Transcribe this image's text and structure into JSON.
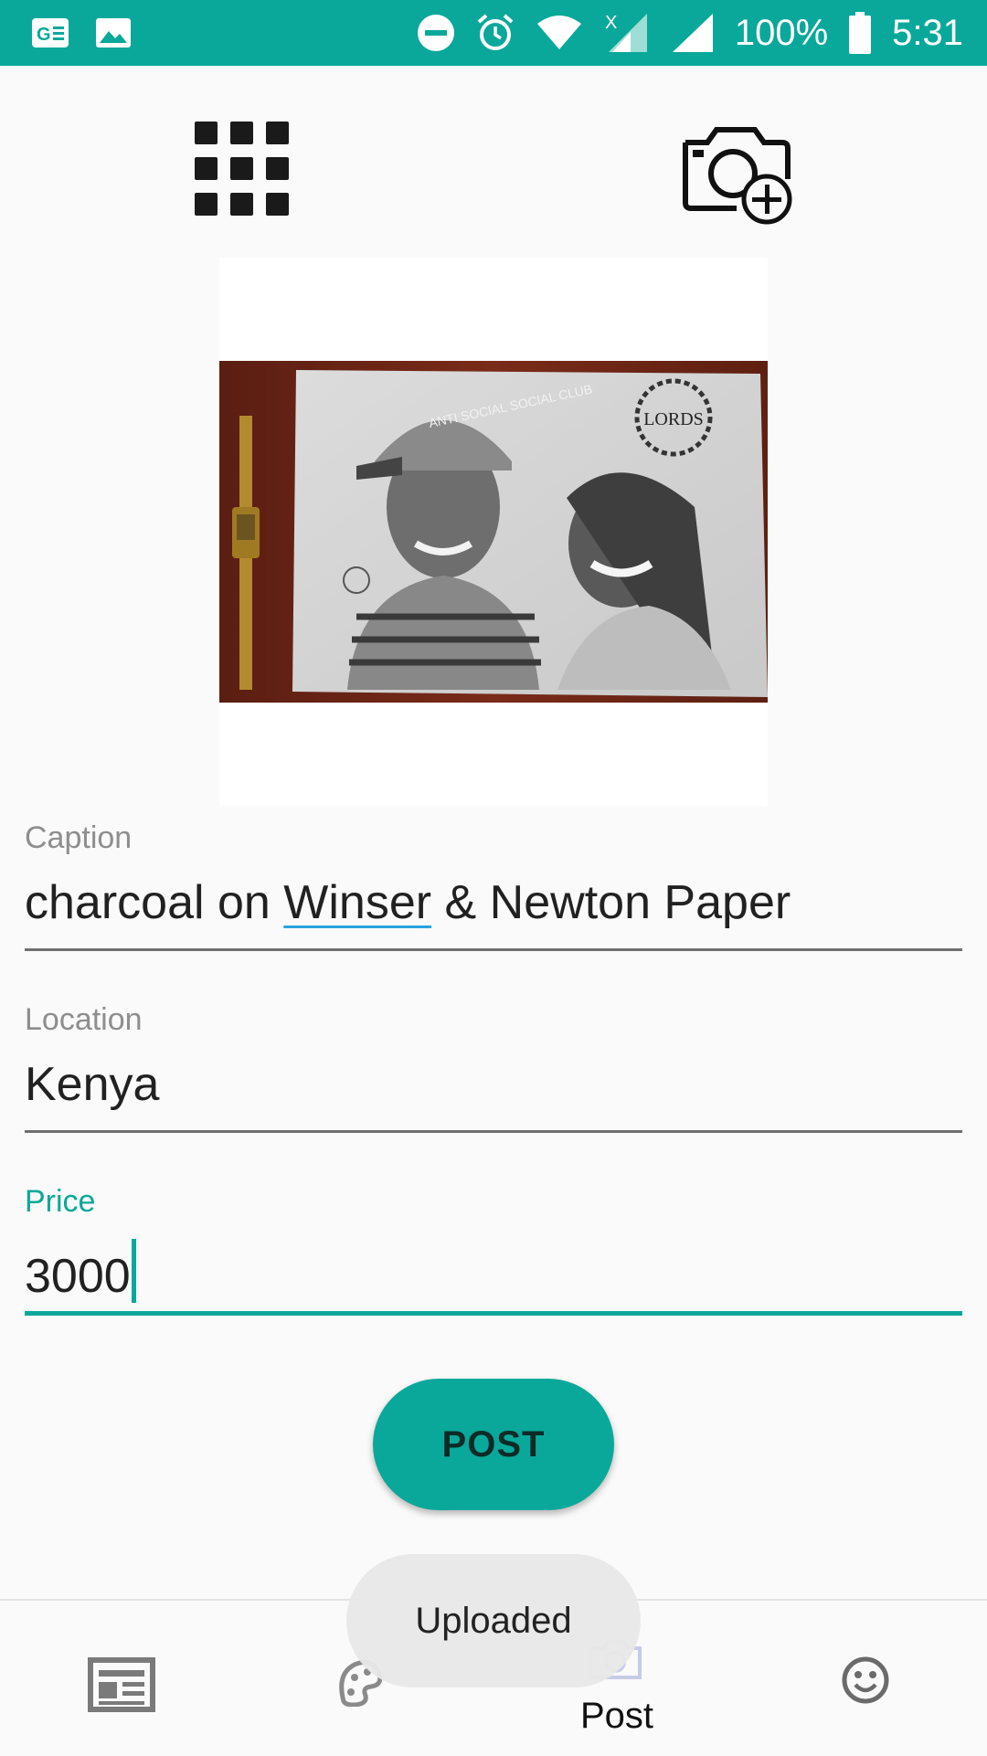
{
  "status_bar": {
    "battery": "100%",
    "time": "5:31",
    "icons": [
      "news-notification-icon",
      "image-notification-icon",
      "do-not-disturb-icon",
      "alarm-icon",
      "wifi-icon",
      "no-data-signal-icon",
      "signal-icon",
      "battery-icon"
    ],
    "background_color": "#0aa89a"
  },
  "toolbar": {
    "left_icon": "grid-icon",
    "right_icon": "camera-add-icon"
  },
  "preview": {
    "image_description_icon": "photo-preview",
    "stamp_text": "LORDS",
    "cap_text": "ANTI SOCIAL SOCIAL CLUB"
  },
  "form": {
    "caption": {
      "label": "Caption",
      "value_before": "charcoal on ",
      "value_misspelled": "Winser",
      "value_after": " & Newton Paper"
    },
    "location": {
      "label": "Location",
      "value": "Kenya"
    },
    "price": {
      "label": "Price",
      "value": "3000"
    }
  },
  "post_button": {
    "label": "POST"
  },
  "toast": {
    "text": "Uploaded"
  },
  "bottom_nav": {
    "items": [
      {
        "icon": "newspaper-icon",
        "label": ""
      },
      {
        "icon": "palette-icon",
        "label": ""
      },
      {
        "icon": "camera-icon",
        "label": "Post"
      },
      {
        "icon": "smiley-icon",
        "label": ""
      }
    ]
  },
  "colors": {
    "accent": "#0aa89a",
    "spellcheck_underline": "#29a3e0"
  }
}
